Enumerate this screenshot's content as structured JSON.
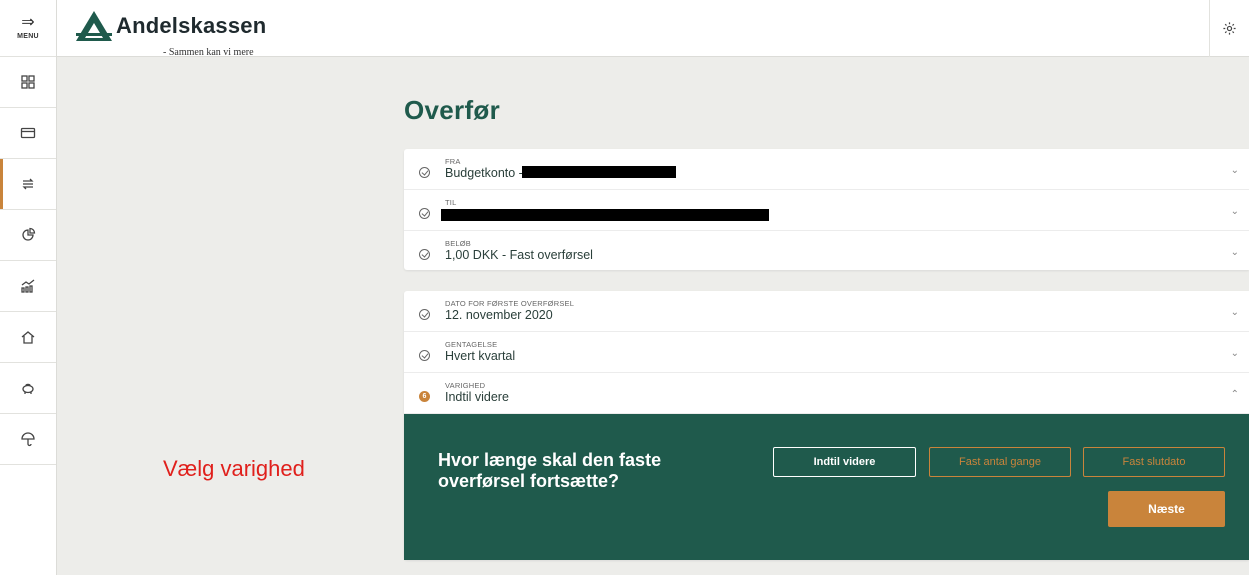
{
  "menu": {
    "label": "MENU",
    "icon": "menu-arrow-icon"
  },
  "nav_items": [
    {
      "name": "overview",
      "icon": "grid-icon",
      "active": false
    },
    {
      "name": "cards",
      "icon": "card-icon",
      "active": false
    },
    {
      "name": "transfer",
      "icon": "transfer-icon",
      "active": true
    },
    {
      "name": "budget",
      "icon": "pie-chart-icon",
      "active": false
    },
    {
      "name": "investments",
      "icon": "chart-up-icon",
      "active": false
    },
    {
      "name": "home",
      "icon": "house-icon",
      "active": false
    },
    {
      "name": "savings",
      "icon": "piggy-bank-icon",
      "active": false
    },
    {
      "name": "insurance",
      "icon": "umbrella-icon",
      "active": false
    }
  ],
  "brand": {
    "name": "Andelskassen",
    "tagline": "- Sammen kan vi mere",
    "color": "#1f5a4c"
  },
  "page": {
    "title": "Overfør"
  },
  "transfer": {
    "from": {
      "label": "FRA",
      "value": "Budgetkonto -"
    },
    "to": {
      "label": "TIL",
      "value": ""
    },
    "amount": {
      "label": "BELØB",
      "value": "1,00 DKK - Fast overførsel"
    }
  },
  "schedule": {
    "first_date": {
      "label": "DATO FOR FØRSTE OVERFØRSEL",
      "value": "12. november 2020"
    },
    "repeat": {
      "label": "GENTAGELSE",
      "value": "Hvert kvartal"
    },
    "duration": {
      "label": "VARIGHED",
      "value": "Indtil videre",
      "step": "6"
    }
  },
  "duration_panel": {
    "question": "Hvor længe skal den faste overførsel fortsætte?",
    "options": [
      "Indtil videre",
      "Fast antal gange",
      "Fast slutdato"
    ],
    "selected": "Indtil videre",
    "next_label": "Næste"
  },
  "annotation": "Vælg varighed",
  "colors": {
    "accent": "#c9843b",
    "panel": "#1f5a4c",
    "annotation": "#e0201c"
  }
}
